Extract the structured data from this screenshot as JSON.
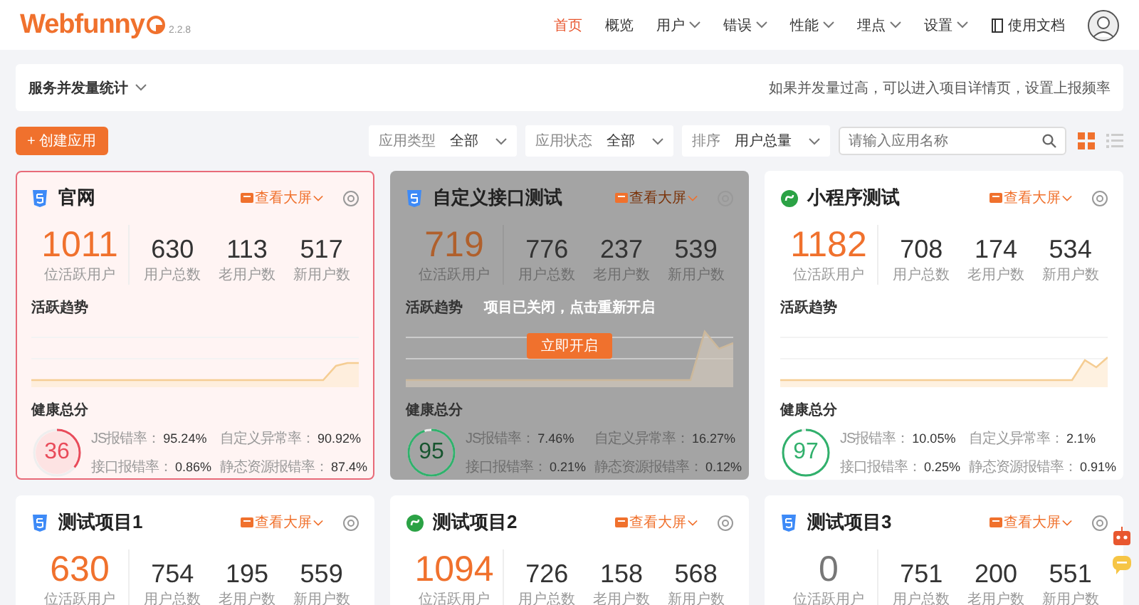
{
  "header": {
    "logo": "Webfunny",
    "version": "2.2.8",
    "nav": [
      {
        "label": "首页",
        "selected": true,
        "dropdown": false
      },
      {
        "label": "概览",
        "selected": false,
        "dropdown": false
      },
      {
        "label": "用户",
        "selected": false,
        "dropdown": true
      },
      {
        "label": "错误",
        "selected": false,
        "dropdown": true
      },
      {
        "label": "性能",
        "selected": false,
        "dropdown": true
      },
      {
        "label": "埋点",
        "selected": false,
        "dropdown": true
      },
      {
        "label": "设置",
        "selected": false,
        "dropdown": true
      }
    ],
    "docs_link": "使用文档"
  },
  "stats_bar": {
    "title": "服务并发量统计",
    "hint": "如果并发量过高，可以进入项目详情页，设置上报频率"
  },
  "toolbar": {
    "create_button": "+ 创建应用",
    "filters": [
      {
        "label": "应用类型",
        "value": "全部"
      },
      {
        "label": "应用状态",
        "value": "全部"
      },
      {
        "label": "排序",
        "value": "用户总量"
      }
    ],
    "search": {
      "placeholder": "请输入应用名称"
    },
    "views": [
      {
        "kind": "grid",
        "selected": true
      },
      {
        "kind": "list",
        "selected": false
      }
    ]
  },
  "cards": [
    {
      "kind": "web",
      "title": "官网",
      "selected": true,
      "closed": false,
      "screen_link": "查看大屏",
      "active_highlight": true,
      "stats": [
        {
          "value": "1011",
          "label": "位活跃用户"
        },
        {
          "value": "630",
          "label": "用户总数"
        },
        {
          "value": "113",
          "label": "老用户数"
        },
        {
          "value": "517",
          "label": "新用户数"
        }
      ],
      "trend_title": "活跃趋势",
      "health_title": "健康总分",
      "health": {
        "score": "36",
        "level": 0.36,
        "color": "#e94b5a"
      },
      "metrics": [
        {
          "label": "JS报错率：",
          "value": "95.24%"
        },
        {
          "label": "自定义异常率：",
          "value": "90.92%"
        },
        {
          "label": "接口报错率：",
          "value": "0.86%"
        },
        {
          "label": "静态资源报错率：",
          "value": "87.4%"
        }
      ]
    },
    {
      "kind": "web",
      "title": "自定义接口测试",
      "selected": false,
      "closed": true,
      "screen_link": "查看大屏",
      "active_highlight": true,
      "stats": [
        {
          "value": "719",
          "label": "位活跃用户"
        },
        {
          "value": "776",
          "label": "用户总数"
        },
        {
          "value": "237",
          "label": "老用户数"
        },
        {
          "value": "539",
          "label": "新用户数"
        }
      ],
      "trend_title": "活跃趋势",
      "health_title": "健康总分",
      "health": {
        "score": "95",
        "level": 0.95,
        "color": "#31b06c"
      },
      "metrics": [
        {
          "label": "JS报错率：",
          "value": "7.46%"
        },
        {
          "label": "自定义异常率：",
          "value": "16.27%"
        },
        {
          "label": "接口报错率：",
          "value": "0.21%"
        },
        {
          "label": "静态资源报错率：",
          "value": "0.12%"
        }
      ],
      "overlay": {
        "message": "项目已关闭，点击重新开启",
        "button": "立即开启"
      }
    },
    {
      "kind": "miniprogram",
      "title": "小程序测试",
      "selected": false,
      "closed": false,
      "screen_link": "查看大屏",
      "active_highlight": true,
      "stats": [
        {
          "value": "1182",
          "label": "位活跃用户"
        },
        {
          "value": "708",
          "label": "用户总数"
        },
        {
          "value": "174",
          "label": "老用户数"
        },
        {
          "value": "534",
          "label": "新用户数"
        }
      ],
      "trend_title": "活跃趋势",
      "health_title": "健康总分",
      "health": {
        "score": "97",
        "level": 0.97,
        "color": "#31b06c"
      },
      "metrics": [
        {
          "label": "JS报错率：",
          "value": "10.05%"
        },
        {
          "label": "自定义异常率：",
          "value": "2.1%"
        },
        {
          "label": "接口报错率：",
          "value": "0.25%"
        },
        {
          "label": "静态资源报错率：",
          "value": "0.91%"
        }
      ]
    },
    {
      "kind": "web",
      "title": "测试项目1",
      "selected": false,
      "closed": false,
      "screen_link": "查看大屏",
      "active_highlight": true,
      "stats": [
        {
          "value": "630",
          "label": "位活跃用户"
        },
        {
          "value": "754",
          "label": "用户总数"
        },
        {
          "value": "195",
          "label": "老用户数"
        },
        {
          "value": "559",
          "label": "新用户数"
        }
      ]
    },
    {
      "kind": "miniprogram",
      "title": "测试项目2",
      "selected": false,
      "closed": false,
      "screen_link": "查看大屏",
      "active_highlight": true,
      "stats": [
        {
          "value": "1094",
          "label": "位活跃用户"
        },
        {
          "value": "726",
          "label": "用户总数"
        },
        {
          "value": "158",
          "label": "老用户数"
        },
        {
          "value": "568",
          "label": "新用户数"
        }
      ]
    },
    {
      "kind": "web",
      "title": "测试项目3",
      "selected": false,
      "closed": false,
      "screen_link": "查看大屏",
      "active_highlight": false,
      "stats": [
        {
          "value": "0",
          "label": "位活跃用户"
        },
        {
          "value": "751",
          "label": "用户总数"
        },
        {
          "value": "200",
          "label": "老用户数"
        },
        {
          "value": "551",
          "label": "新用户数"
        }
      ]
    }
  ]
}
